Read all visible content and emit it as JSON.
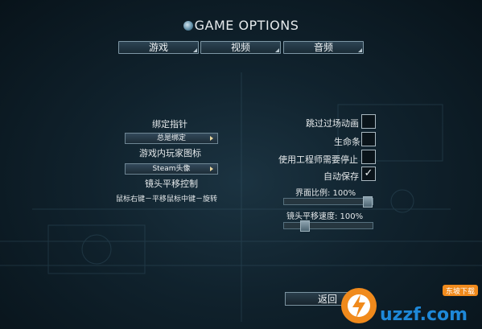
{
  "header": {
    "title": "GAME OPTIONS"
  },
  "tabs": [
    {
      "label": "游戏"
    },
    {
      "label": "视频"
    },
    {
      "label": "音频"
    }
  ],
  "left": {
    "bind_pointer_label": "绑定指针",
    "bind_pointer_value": "总是绑定",
    "player_icon_label": "游戏内玩家图标",
    "player_icon_value": "Steam头像",
    "camera_pan_label": "镜头平移控制",
    "camera_pan_hint": "鼠标右键－平移鼠标中键－旋转"
  },
  "right": {
    "skip_cutscene_label": "跳过过场动画",
    "skip_cutscene_checked": false,
    "health_bar_label": "生命条",
    "health_bar_checked": false,
    "engineer_stop_label": "使用工程师需要停止",
    "engineer_stop_checked": false,
    "autosave_label": "自动保存",
    "autosave_checked": true,
    "checkmark": "✓",
    "ui_scale_label": "界面比例:  100%",
    "ui_scale_value": 1.0,
    "camera_speed_label": "镜头平移速度:  100%",
    "camera_speed_value": 0.2
  },
  "footer": {
    "back_label": "返回"
  },
  "watermark": {
    "text": "uzzf.com",
    "badge": "东坡下载"
  },
  "colors": {
    "accent": "#7e97a5",
    "dropdown_arrow": "#e8d7a0",
    "watermark_orange": "#f08a1c",
    "watermark_blue": "#1e88d8"
  }
}
